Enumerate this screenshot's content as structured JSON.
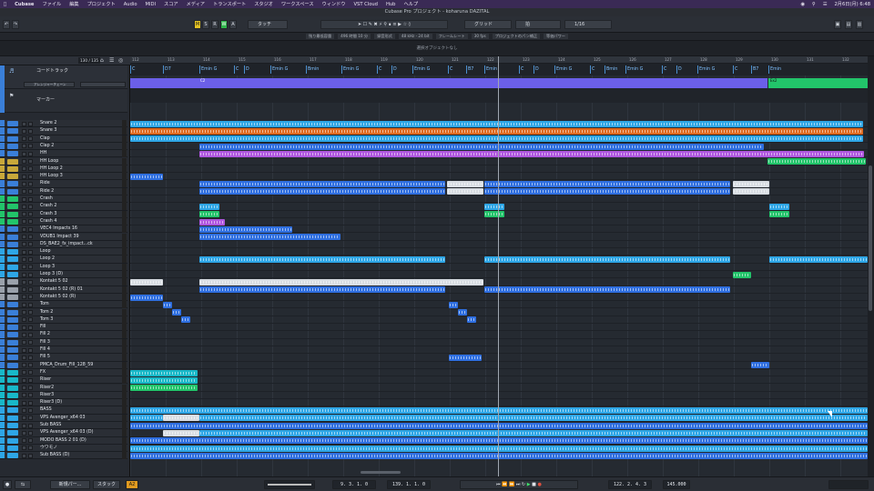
{
  "menubar": {
    "app": "Cubase",
    "items": [
      "ファイル",
      "編集",
      "プロジェクト",
      "Audio",
      "MIDI",
      "スコア",
      "メディア",
      "トランスポート",
      "スタジオ",
      "ワークスペース",
      "ウィンドウ",
      "VST Cloud",
      "Hub",
      "ヘルプ"
    ],
    "clock": "2月6日(月) 6:48"
  },
  "window": {
    "title": "Cubase Pro プロジェクト - koharuna DAZITAL"
  },
  "toolbar": {
    "automation_mode": "タッチ",
    "snap_type": "グリッド",
    "grid": "拍",
    "quantize": "1/16",
    "letters": [
      "M",
      "S",
      "R",
      "W",
      "A"
    ]
  },
  "infobar": [
    "残り最低容量",
    "496 時間 10 分",
    "録音形式",
    "48 kHz - 24 bit",
    "フレームレート",
    "30 fps",
    "プロジェクトのパン補正",
    "等価パワー"
  ],
  "status": "選択オブジェクトなし",
  "tracklist": {
    "counter": "130 / 135",
    "chord_track": "コードトラック",
    "arranger": "アレンジャーチェーン",
    "marker": "マーカー",
    "tracks": [
      "Snare 2",
      "Snare 3",
      "Clap",
      "Clap 2",
      "HH",
      "HH Loop",
      "HH Loop 2",
      "HH Loop 3",
      "Ride",
      "Ride 2",
      "Crash",
      "Crash 2",
      "Crash 3",
      "Crash 4",
      "VEC4 Impacts 16",
      "VDUB1 Impact 39",
      "DS_BAE2_fx_impact...ck",
      "Loop",
      "Loop 2",
      "Loop 3",
      "Loop 3 (D)",
      "Kontakt 5 02",
      "Kontakt 5 02 (R) 01",
      "Kontakt 5 02 (R)",
      "Tom",
      "Tom 2",
      "Tom 3",
      "Fill",
      "Fill 2",
      "Fill 3",
      "Fill 4",
      "Fill 5",
      "PMCA_Drum_Fill_128_59",
      "FX",
      "Riser",
      "Riser2",
      "Riser3",
      "Riser3 (D)",
      "BASS",
      "VPS Avenger_x64 03",
      "Sub BASS",
      "VPS Avenger_x64 03 (D)",
      "MODO BASS 2 01 (D)",
      "ウワモノ",
      "Sub BASS (D)"
    ]
  },
  "ruler": [
    "112",
    "113",
    "114",
    "115",
    "116",
    "117",
    "118",
    "119",
    "120",
    "121",
    "122",
    "123",
    "124",
    "125",
    "126",
    "127",
    "128",
    "129",
    "130",
    "131",
    "132"
  ],
  "chords": [
    "C",
    "D7",
    "Emin G",
    "C",
    "D",
    "Emin G",
    "Bmin",
    "Emin G",
    "C",
    "D",
    "Emin G",
    "C",
    "B7",
    "Emin",
    "C",
    "D",
    "Emin G",
    "C",
    "Bmin",
    "Emin G",
    "C",
    "D",
    "Emin G",
    "C",
    "B7",
    "Emin"
  ],
  "arranger_labels": [
    "C2",
    "Ex2"
  ],
  "transport": {
    "left_locator": "9. 3. 1.   0",
    "right_locator": "139. 1. 1.   0",
    "position": "122. 2. 4.   3",
    "tempo": "145.000",
    "track_view": "新規パー...",
    "stack": "スタック",
    "key": "A2"
  },
  "colors": {
    "accent": "#3a7fd8",
    "marker": "#22c46a",
    "chord": "#7fc1ff"
  }
}
